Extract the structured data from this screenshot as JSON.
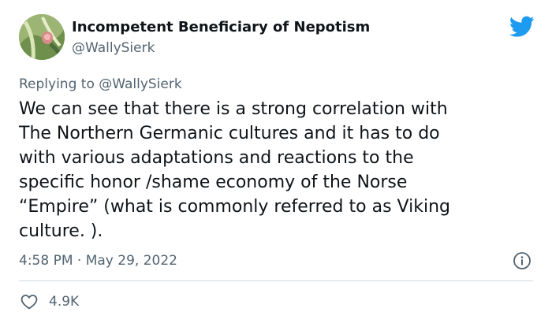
{
  "author": {
    "display_name": "Incompetent Beneficiary of Nepotism",
    "handle": "@WallySierk",
    "avatar_icon": "avatar-image"
  },
  "reply": {
    "prefix": "Replying to ",
    "to_handle": "@WallySierk"
  },
  "tweet": {
    "text": "We can see that there is a strong correlation with\nThe Northern Germanic cultures and it has to do\nwith various adaptations and reactions to the\nspecific honor /shame economy of the Norse\n“Empire” (what is commonly referred to as Viking\nculture. ).",
    "time": "4:58 PM",
    "separator": " · ",
    "date": "May 29, 2022"
  },
  "actions": {
    "like_count": "4.9K",
    "like_icon": "heart-icon",
    "info_icon": "info-icon"
  },
  "brand": {
    "logo_icon": "twitter-logo-icon",
    "accent_color": "#1d9bf0",
    "text_color": "#0f1419",
    "secondary_color": "#536471",
    "divider_color": "#cfd9de"
  }
}
